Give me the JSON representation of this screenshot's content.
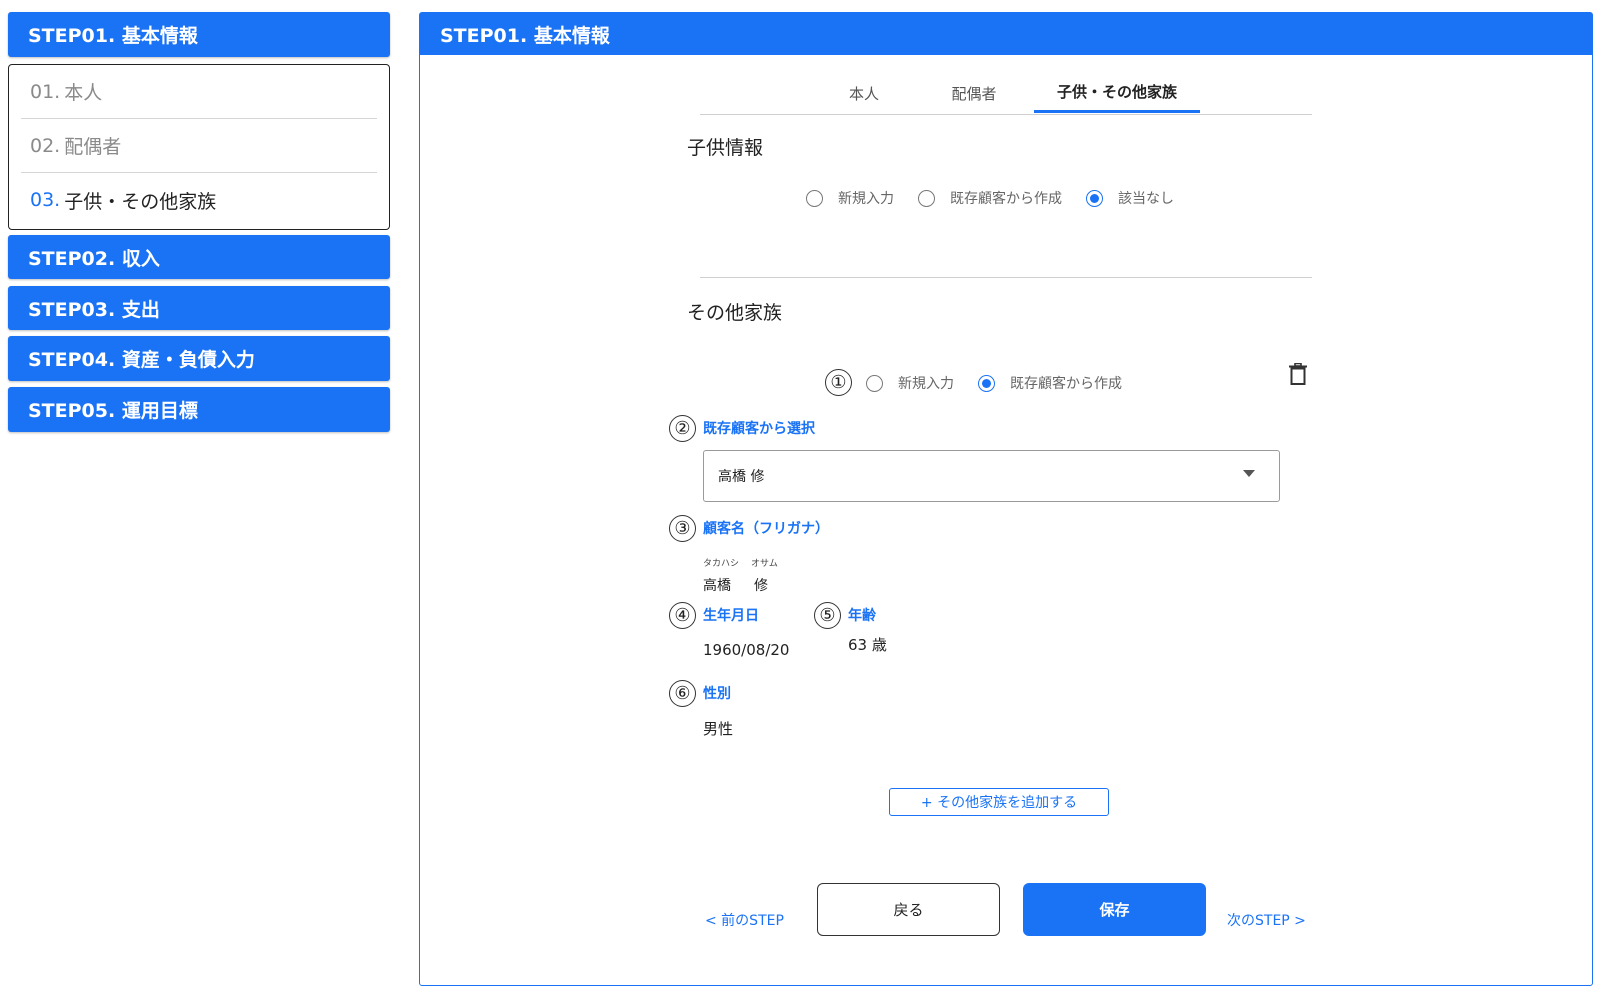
{
  "sidebar": {
    "step1": "STEP01. 基本情報",
    "sub_items": [
      {
        "num": "01.",
        "label": "本人"
      },
      {
        "num": "02.",
        "label": "配偶者"
      },
      {
        "num": "03.",
        "label": "子供・その他家族"
      }
    ],
    "step2": "STEP02. 収入",
    "step3": "STEP03. 支出",
    "step4": "STEP04. 資産・負債入力",
    "step5": "STEP05. 運用目標"
  },
  "main": {
    "header": "STEP01. 基本情報",
    "tabs": [
      "本人",
      "配偶者",
      "子供・その他家族"
    ],
    "active_tab": 2,
    "children": {
      "title": "子供情報",
      "options": [
        "新規入力",
        "既存顧客から作成",
        "該当なし"
      ],
      "selected": 2
    },
    "other": {
      "title": "その他家族",
      "options": [
        "新規入力",
        "既存顧客から作成"
      ],
      "selected": 1,
      "markers": [
        "①",
        "②",
        "③",
        "④",
        "⑤",
        "⑥"
      ],
      "select_label": "既存顧客から選択",
      "select_value": "高橋 修",
      "name_label": "顧客名（フリガナ）",
      "kana_last": "タカハシ",
      "kana_first": "オサム",
      "name_last": "高橋",
      "name_first": "修",
      "birth_label": "生年月日",
      "birth_value": "1960/08/20",
      "age_label": "年齢",
      "age_value": "63 歳",
      "gender_label": "性別",
      "gender_value": "男性"
    },
    "add_button": "+ その他家族を追加する",
    "prev_link": "< 前のSTEP",
    "back_button": "戻る",
    "save_button": "保存",
    "next_link": "次のSTEP >"
  },
  "colors": {
    "accent": "#1a73f5"
  }
}
